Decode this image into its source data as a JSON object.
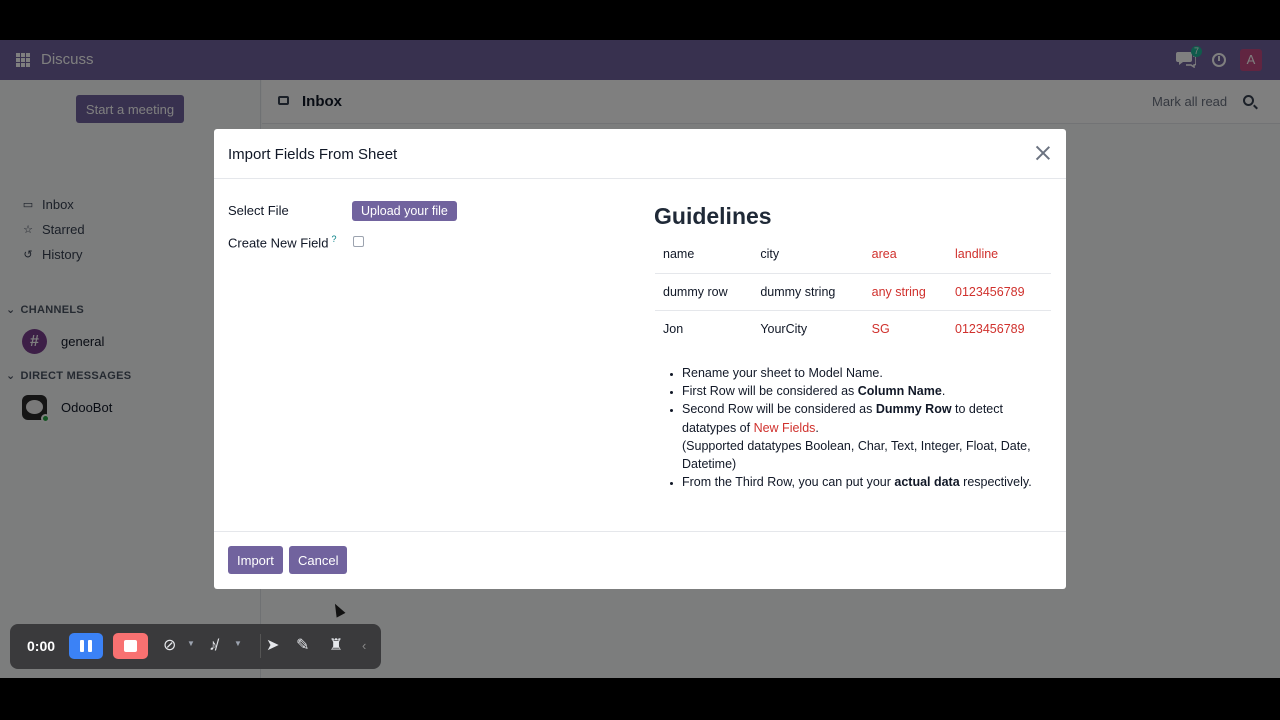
{
  "navbar": {
    "app_title": "Discuss",
    "chat_count": "7",
    "avatar_letter": "A"
  },
  "sidebar": {
    "start_meeting": "Start a meeting",
    "items": [
      {
        "label": "Inbox",
        "icon": "inbox-icon"
      },
      {
        "label": "Starred",
        "icon": "star-icon"
      },
      {
        "label": "History",
        "icon": "history-icon"
      }
    ],
    "channels_heading": "CHANNELS",
    "channel_general": "general",
    "dm_heading": "DIRECT MESSAGES",
    "dm_odoobot": "OdooBot"
  },
  "main": {
    "title": "Inbox",
    "mark_all_read": "Mark all read"
  },
  "modal": {
    "title": "Import Fields From Sheet",
    "select_file_label": "Select File",
    "upload_button": "Upload your file",
    "create_field_label": "Create New Field",
    "help_mark": "?",
    "guidelines_title": "Guidelines",
    "table": [
      [
        "name",
        "city",
        "area",
        "landline"
      ],
      [
        "dummy row",
        "dummy string",
        "any string",
        "0123456789"
      ],
      [
        "Jon",
        "YourCity",
        "SG",
        "0123456789"
      ]
    ],
    "rules": {
      "r1": "Rename your sheet to Model Name.",
      "r2_pre": "First Row will be considered as ",
      "r2_bold": "Column Name",
      "r2_post": ".",
      "r3_pre": "Second Row will be considered as ",
      "r3_bold": "Dummy Row",
      "r3_mid": " to detect datatypes of ",
      "r3_red": "New Fields",
      "r3_post": ".",
      "r3_support": "(Supported datatypes Boolean, Char, Text, Integer, Float, Date, Datetime)",
      "r4_pre": "From the Third Row, you can put your ",
      "r4_bold": "actual data",
      "r4_post": " respectively."
    },
    "import_button": "Import",
    "cancel_button": "Cancel"
  },
  "recorder": {
    "time": "0:00"
  },
  "colors": {
    "brand": "#71639e",
    "highlight": "#d0312d",
    "pause": "#3b82f6",
    "stop": "#f87171"
  }
}
